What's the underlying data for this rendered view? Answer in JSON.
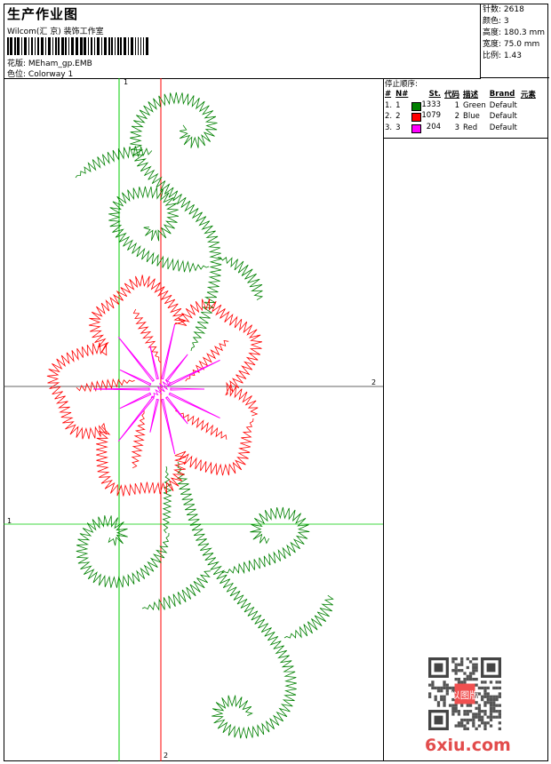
{
  "header": {
    "title": "生产作业图",
    "company": "Wilcom(汇 京) 装饰工作室",
    "design_label": "花版:",
    "design_value": "MEham_gp.EMB",
    "colorway_label": "色位:",
    "colorway_value": "Colorway 1"
  },
  "stats": {
    "stitches": "针数: 2618",
    "colors": "颜色: 3",
    "height": "高度: 180.3 mm",
    "width": "宽度: 75.0 mm",
    "scale": "比例: 1.43"
  },
  "stop_sequence": {
    "title": "停止顺序:",
    "columns": [
      "#",
      "N#",
      "St.",
      "代码",
      "描述",
      "Brand",
      "元素"
    ],
    "rows": [
      {
        "idx": "1.",
        "n": "1",
        "color": "#008000",
        "st": "1333",
        "code": "1",
        "desc": "Green",
        "brand": "Default"
      },
      {
        "idx": "2.",
        "n": "2",
        "color": "#ff0000",
        "st": "1079",
        "code": "2",
        "desc": "Blue",
        "brand": "Default"
      },
      {
        "idx": "3.",
        "n": "3",
        "color": "#ff00ff",
        "st": "204",
        "code": "3",
        "desc": "Red",
        "brand": "Default"
      }
    ]
  },
  "markers": {
    "v1": "1",
    "h2": "2",
    "h1": "1",
    "v2": "2"
  },
  "watermark": {
    "text": "6xiu.com",
    "stamp": "以图版"
  },
  "colors": {
    "green": "#008000",
    "red": "#ff0000",
    "magenta": "#ff00ff",
    "guide_green": "#00cc00",
    "guide_red": "#ff0000"
  }
}
